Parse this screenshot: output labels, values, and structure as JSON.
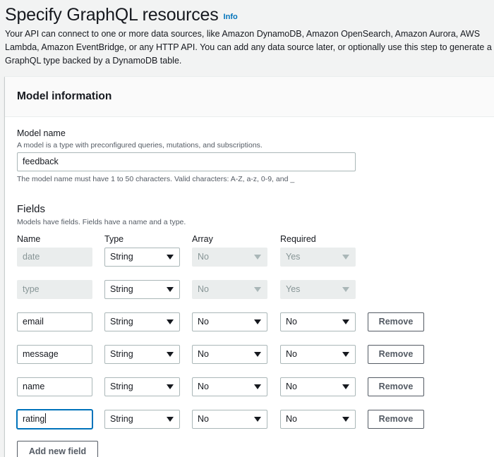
{
  "header": {
    "title": "Specify GraphQL resources",
    "info_link": "Info",
    "description": "Your API can connect to one or more data sources, like Amazon DynamoDB, Amazon OpenSearch, Amazon Aurora, AWS Lambda, Amazon EventBridge, or any HTTP API. You can add any data source later, or optionally use this step to generate a GraphQL type backed by a DynamoDB table."
  },
  "panel": {
    "title": "Model information",
    "model_name": {
      "label": "Model name",
      "description": "A model is a type with preconfigured queries, mutations, and subscriptions.",
      "value": "feedback",
      "constraint": "The model name must have 1 to 50 characters. Valid characters: A-Z, a-z, 0-9, and _"
    },
    "fields": {
      "heading": "Fields",
      "description": "Models have fields. Fields have a name and a type.",
      "columns": {
        "name": "Name",
        "type": "Type",
        "array": "Array",
        "required": "Required"
      },
      "rows": [
        {
          "name": "date",
          "type": "String",
          "array": "No",
          "required": "Yes",
          "locked": true
        },
        {
          "name": "type",
          "type": "String",
          "array": "No",
          "required": "Yes",
          "locked": true
        },
        {
          "name": "email",
          "type": "String",
          "array": "No",
          "required": "No",
          "locked": false,
          "remove_label": "Remove"
        },
        {
          "name": "message",
          "type": "String",
          "array": "No",
          "required": "No",
          "locked": false,
          "remove_label": "Remove"
        },
        {
          "name": "name",
          "type": "String",
          "array": "No",
          "required": "No",
          "locked": false,
          "remove_label": "Remove"
        },
        {
          "name": "rating",
          "type": "String",
          "array": "No",
          "required": "No",
          "locked": false,
          "remove_label": "Remove",
          "focused": true
        }
      ],
      "add_button": "Add new field"
    }
  }
}
